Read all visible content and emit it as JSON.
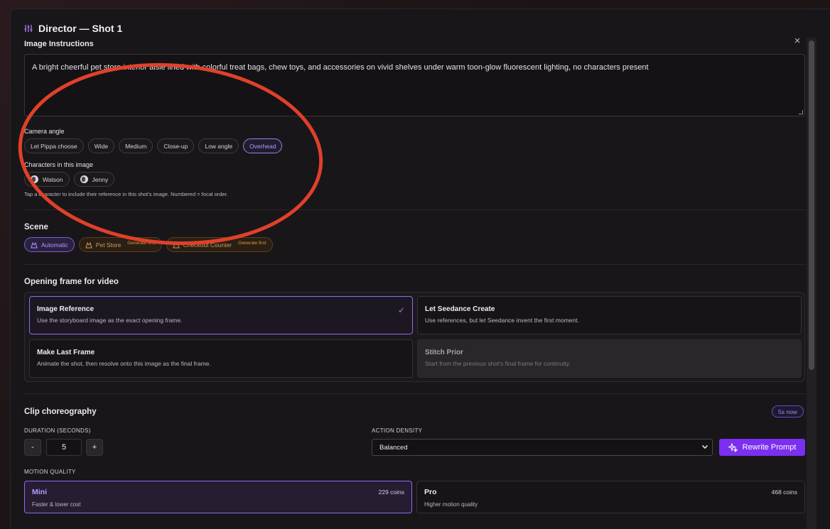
{
  "modal": {
    "title": "Director — Shot 1",
    "close_symbol": "×"
  },
  "image_instructions": {
    "label": "Image Instructions",
    "value": "A bright cheerful pet store interior aisle lined with colorful treat bags, chew toys, and accessories on vivid shelves under warm toon-glow fluorescent lighting, no characters present"
  },
  "camera_angle": {
    "label": "Camera angle",
    "options": [
      "Let Pippa choose",
      "Wide",
      "Medium",
      "Close-up",
      "Low angle",
      "Overhead"
    ],
    "selected": "Overhead"
  },
  "characters": {
    "label": "Characters in this image",
    "items": [
      "Watson",
      "Jenny"
    ],
    "hint": "Tap a character to include their reference in this shot's image. Numbered = focal order."
  },
  "scene": {
    "label": "Scene",
    "options": [
      {
        "label": "Automatic",
        "tag": ""
      },
      {
        "label": "Pet Store",
        "tag": "Generate first"
      },
      {
        "label": "Checkout Counter",
        "tag": "Generate first"
      }
    ]
  },
  "opening_frame": {
    "label": "Opening frame for video",
    "cards": [
      {
        "title": "Image Reference",
        "desc": "Use the storyboard image as the exact opening frame.",
        "check": "✓"
      },
      {
        "title": "Let Seedance Create",
        "desc": "Use references, but let Seedance invent the first moment."
      },
      {
        "title": "Make Last Frame",
        "desc": "Animate the shot, then resolve onto this image as the final frame."
      },
      {
        "title": "Stitch Prior",
        "desc": "Start from the previous shot's final frame for continuity."
      }
    ]
  },
  "clip": {
    "label": "Clip choreography",
    "badge": "5s now",
    "duration_label": "DURATION (SECONDS)",
    "duration_value": "5",
    "minus": "-",
    "plus": "+",
    "density_label": "ACTION DENSITY",
    "density_value": "Balanced",
    "rewrite_label": "Rewrite Prompt",
    "motion_label": "MOTION QUALITY",
    "motion": [
      {
        "title": "Mini",
        "desc": "Faster & lower cost",
        "cost": "229 coins"
      },
      {
        "title": "Pro",
        "desc": "Higher motion quality",
        "cost": "468 coins"
      }
    ]
  },
  "colors": {
    "accent": "#8e6bf0",
    "rewrite_button": "#7b2ff0",
    "annotation_ellipse": "#e0402a"
  },
  "icons": {
    "title_icon": "sliders-icon",
    "close_icon": "close-icon",
    "scene_icon": "tent-icon",
    "check_icon": "check-icon",
    "select_icon": "chevron-down-icon",
    "rewrite_icon": "sparkles-icon"
  }
}
